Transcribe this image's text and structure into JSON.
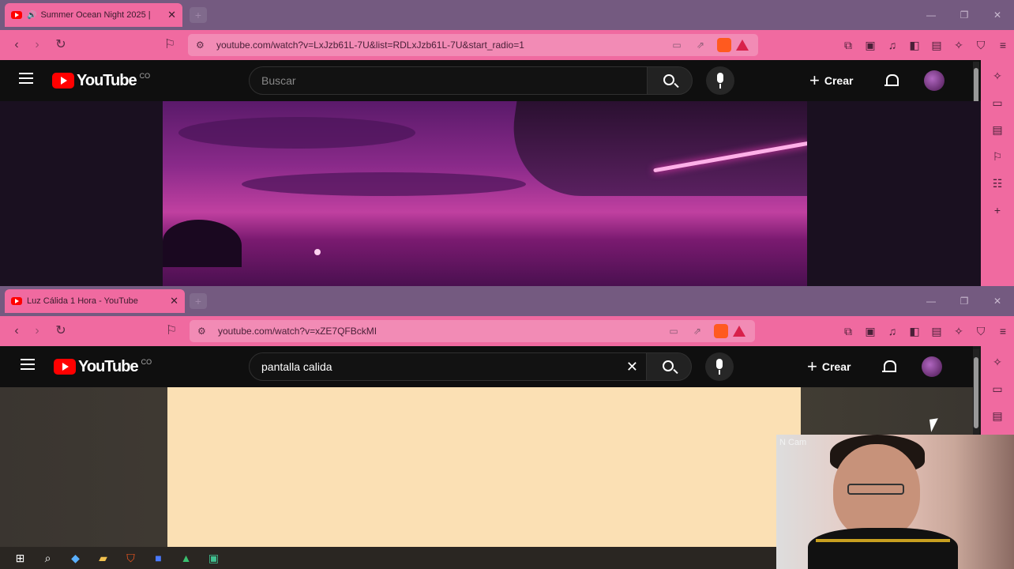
{
  "window1": {
    "tab": {
      "title": "Summer Ocean Night 2025 |",
      "close": "✕",
      "audio_icon": "speaker-icon"
    },
    "new_tab": "+",
    "window_controls": [
      "—",
      "❐",
      "✕"
    ],
    "nav": {
      "back": "‹",
      "forward": "›",
      "reload": "↻",
      "bookmark": "⚐"
    },
    "url": "youtube.com/watch?v=LxJzb61L-7U&list=RDLxJzb61L-7U&start_radio=1",
    "youtube": {
      "logo_text": "YouTube",
      "country": "CO",
      "search_placeholder": "Buscar",
      "create_label": "Crear"
    }
  },
  "window2": {
    "tab": {
      "title": "Luz Cálida 1 Hora - YouTube",
      "close": "✕"
    },
    "new_tab": "+",
    "window_controls": [
      "—",
      "❐",
      "✕"
    ],
    "nav": {
      "back": "‹",
      "forward": "›",
      "reload": "↻",
      "bookmark": "⚐"
    },
    "url": "youtube.com/watch?v=xZE7QFBckMI",
    "youtube": {
      "logo_text": "YouTube",
      "country": "CO",
      "search_value": "pantalla calida",
      "clear": "✕",
      "create_label": "Crear"
    }
  },
  "webcam": {
    "label": "N Cam"
  },
  "colors": {
    "browser_accent": "#f06aa0",
    "tab_strip": "#745a80",
    "yt_bg": "#0f0f0f",
    "warm_screen": "#fbe0b4"
  }
}
